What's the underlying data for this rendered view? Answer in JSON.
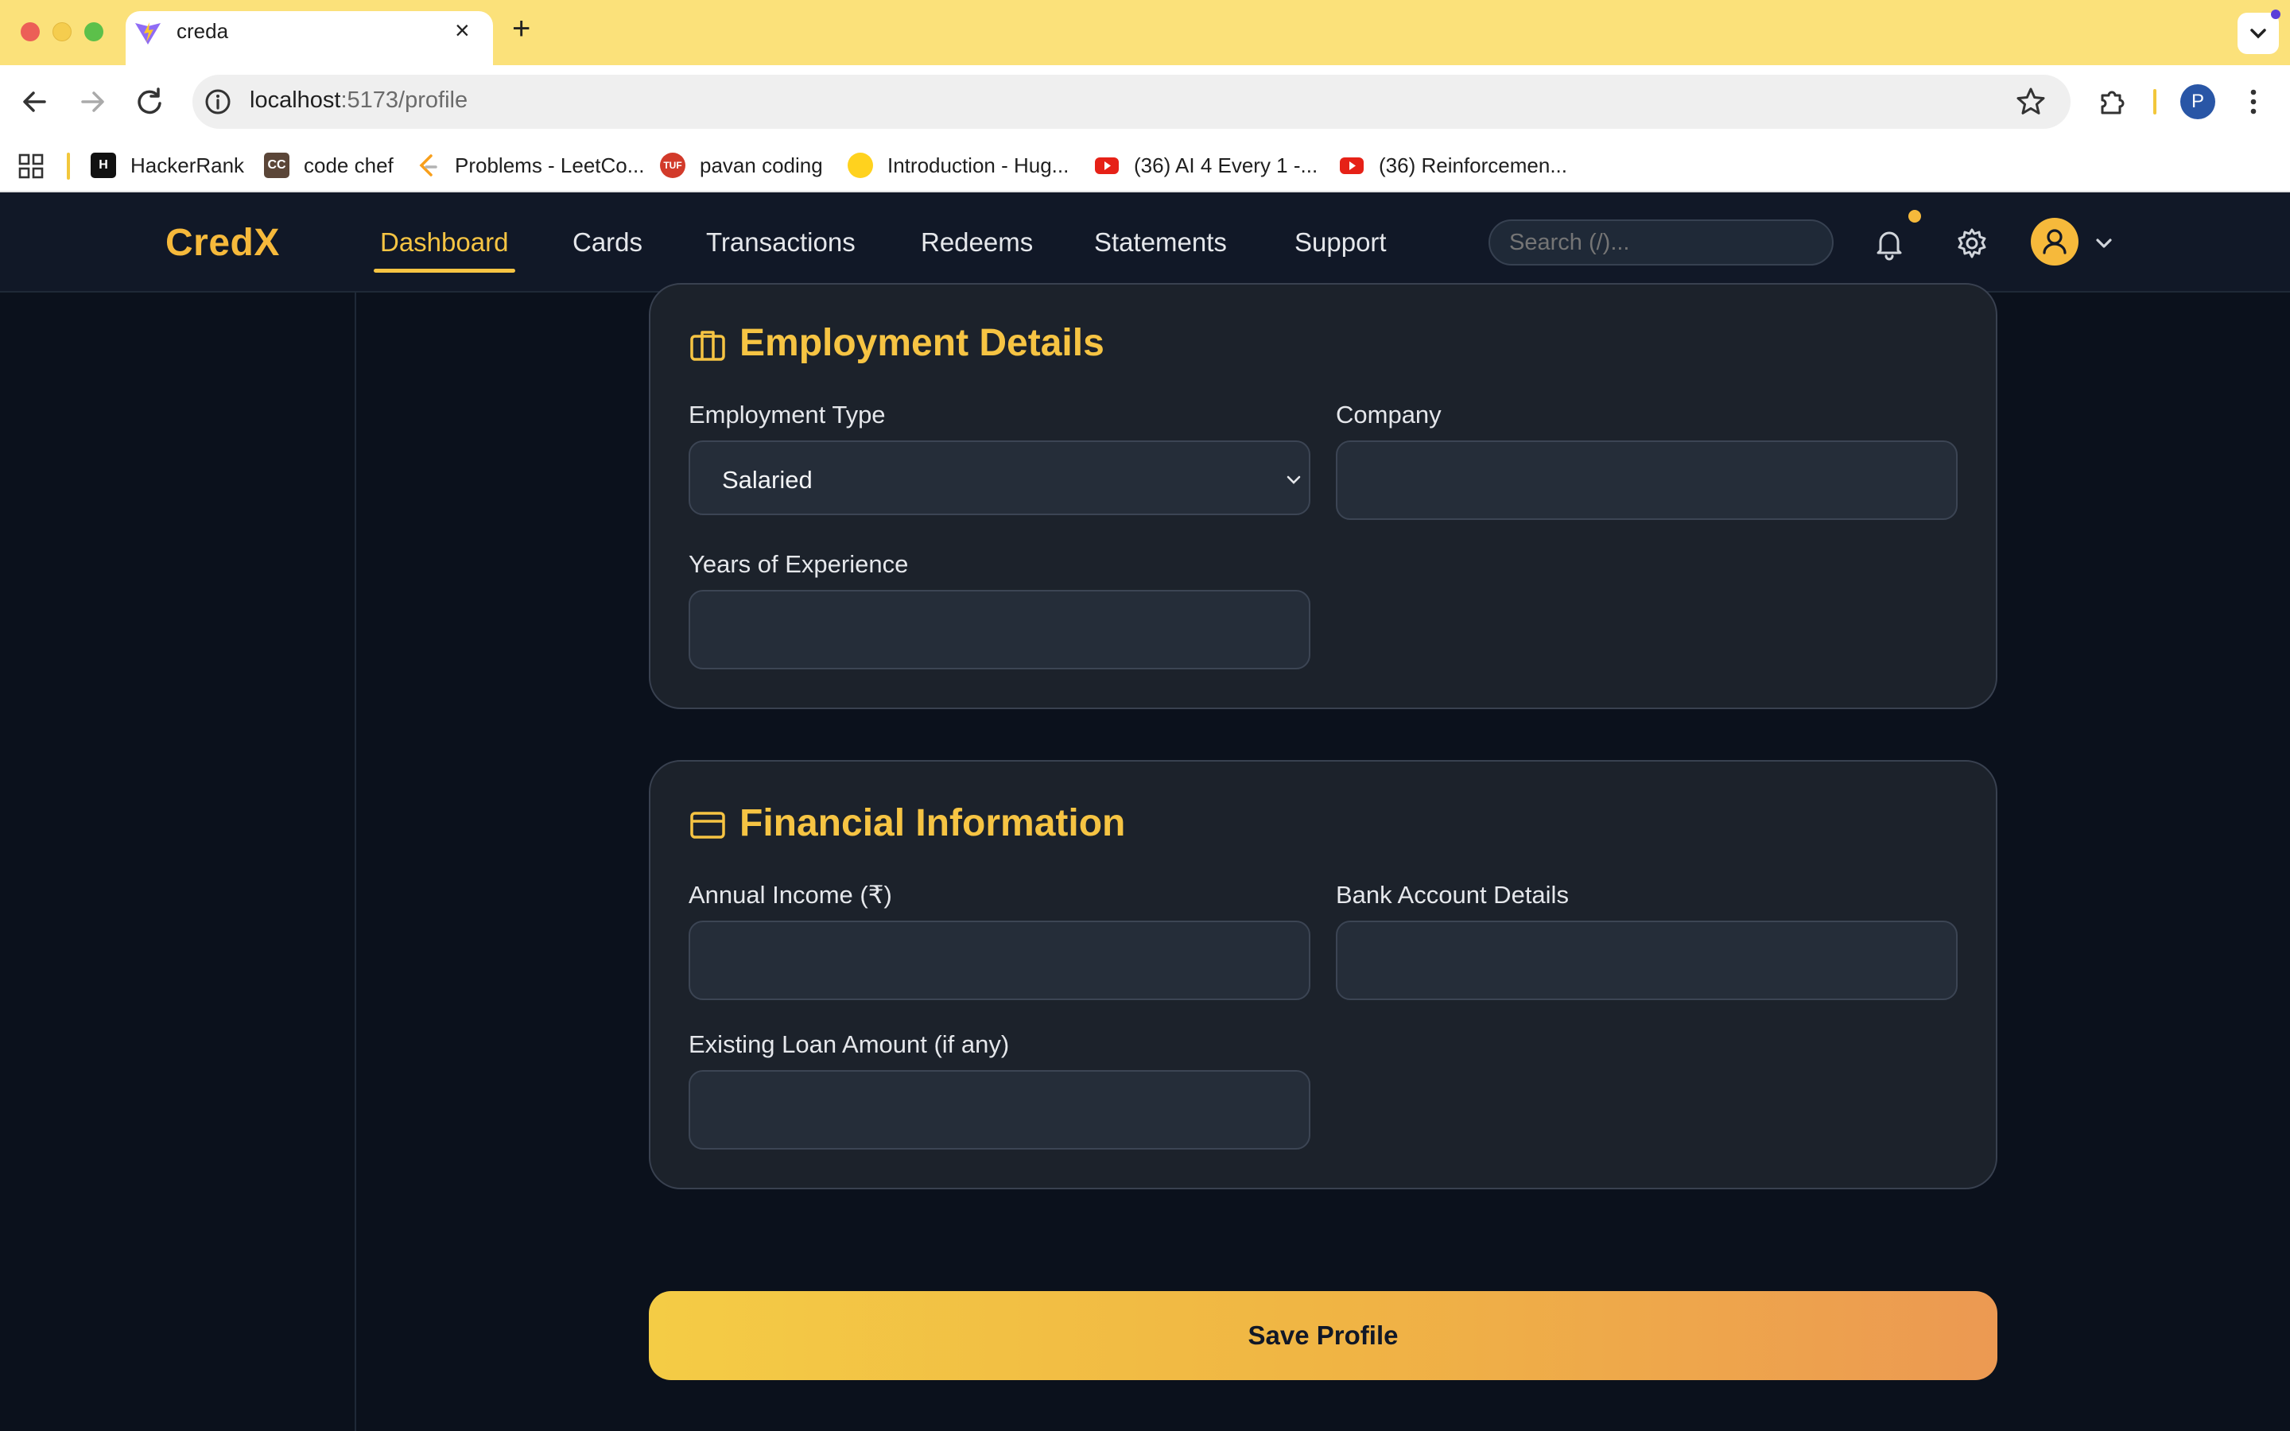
{
  "browser": {
    "tab_title": "creda",
    "url_host": "localhost",
    "url_path": ":5173/profile",
    "profile_initial": "P",
    "bookmarks": [
      {
        "label": "HackerRank",
        "icon": "hackerrank-icon",
        "color": "#000000"
      },
      {
        "label": "code chef",
        "icon": "codechef-icon",
        "color": "#5b4638"
      },
      {
        "label": "Problems - LeetCo...",
        "icon": "leetcode-icon",
        "color": "#ffffff"
      },
      {
        "label": "pavan coding",
        "icon": "tuf-icon",
        "color": "#d23a2a"
      },
      {
        "label": "Introduction - Hug...",
        "icon": "huggingface-icon",
        "color": "#ffd21e"
      },
      {
        "label": "(36) AI 4 Every 1 -...",
        "icon": "youtube-icon",
        "color": "#e62117"
      },
      {
        "label": "(36) Reinforcemen...",
        "icon": "youtube-icon",
        "color": "#e62117"
      }
    ]
  },
  "app": {
    "brand": "CredX",
    "nav": [
      "Dashboard",
      "Cards",
      "Transactions",
      "Redeems",
      "Statements",
      "Support"
    ],
    "active_nav": "Dashboard",
    "search_placeholder": "Search (/)...",
    "accent": "#f6c443"
  },
  "employment": {
    "title": "Employment Details",
    "employment_type_label": "Employment Type",
    "employment_type_value": "Salaried",
    "company_label": "Company",
    "company_value": "",
    "experience_label": "Years of Experience",
    "experience_value": ""
  },
  "financial": {
    "title": "Financial Information",
    "income_label": "Annual Income (₹)",
    "income_value": "",
    "bank_label": "Bank Account Details",
    "bank_value": "",
    "loan_label": "Existing Loan Amount (if any)",
    "loan_value": ""
  },
  "save_label": "Save Profile"
}
